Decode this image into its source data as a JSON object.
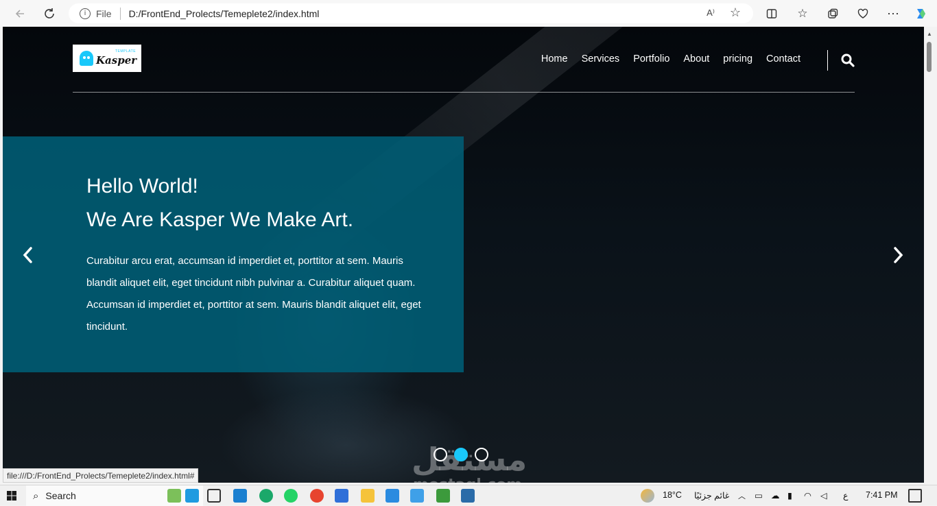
{
  "browser": {
    "address_prefix": "File",
    "url": "D:/FrontEnd_Prolects/Temeplete2/index.html",
    "read_aloud": "A⁾",
    "status_url": "file:///D:/FrontEnd_Prolects/Temeplete2/index.html#"
  },
  "site": {
    "logo_text": "Kasper",
    "logo_tag": "TEMPLATE",
    "nav": [
      "Home",
      "Services",
      "Portfolio",
      "About",
      "pricing",
      "Contact"
    ],
    "hero": {
      "title_line1": "Hello World!",
      "title_line2": "We Are Kasper We Make Art.",
      "paragraph": "Curabitur arcu erat, accumsan id imperdiet et, porttitor at sem. Mauris blandit aliquet elit, eget tincidunt nibh pulvinar a. Curabitur aliquet quam. Accumsan id imperdiet et, porttitor at sem. Mauris blandit aliquet elit, eget tincidunt."
    },
    "slider_dots": 3,
    "active_dot": 2,
    "accent": "#19c8fa",
    "panel_color": "#005e76"
  },
  "watermark": {
    "arabic": "مستقل",
    "latin": "mostaql.com"
  },
  "taskbar": {
    "search_label": "Search",
    "temperature": "18°C",
    "weather": "غائم جزئيًا",
    "language": "ع",
    "time": "7:41 PM"
  }
}
